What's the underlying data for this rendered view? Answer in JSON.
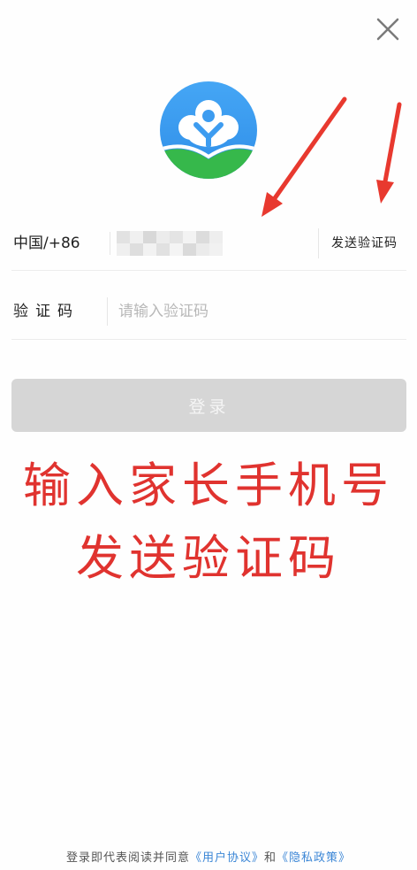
{
  "icons": {
    "close": "close-icon",
    "logo": "app-logo-icon",
    "arrows": "red-arrow-icon"
  },
  "phone_row": {
    "country_code": "中国/+86",
    "send_code_label": "发送验证码"
  },
  "code_row": {
    "label": "验证码",
    "placeholder": "请输入验证码"
  },
  "login_button": {
    "label": "登录"
  },
  "annotation": {
    "line1": "输入家长手机号",
    "line2": "发送验证码"
  },
  "footer": {
    "prefix": "登录即代表阅读并同意",
    "user_agreement": "《用户协议》",
    "conjunction": "和",
    "privacy_policy": "《隐私政策》"
  },
  "colors": {
    "background": "#fefefe",
    "text": "#222222",
    "placeholder": "#b8b8b8",
    "divider": "#ececec",
    "button_disabled": "#d6d6d6",
    "button_text": "#f5f5f5",
    "annotation_red": "#e0332f",
    "link_blue": "#3b86d6",
    "logo_blue": "#3d9cf0",
    "logo_green": "#36b84b"
  }
}
